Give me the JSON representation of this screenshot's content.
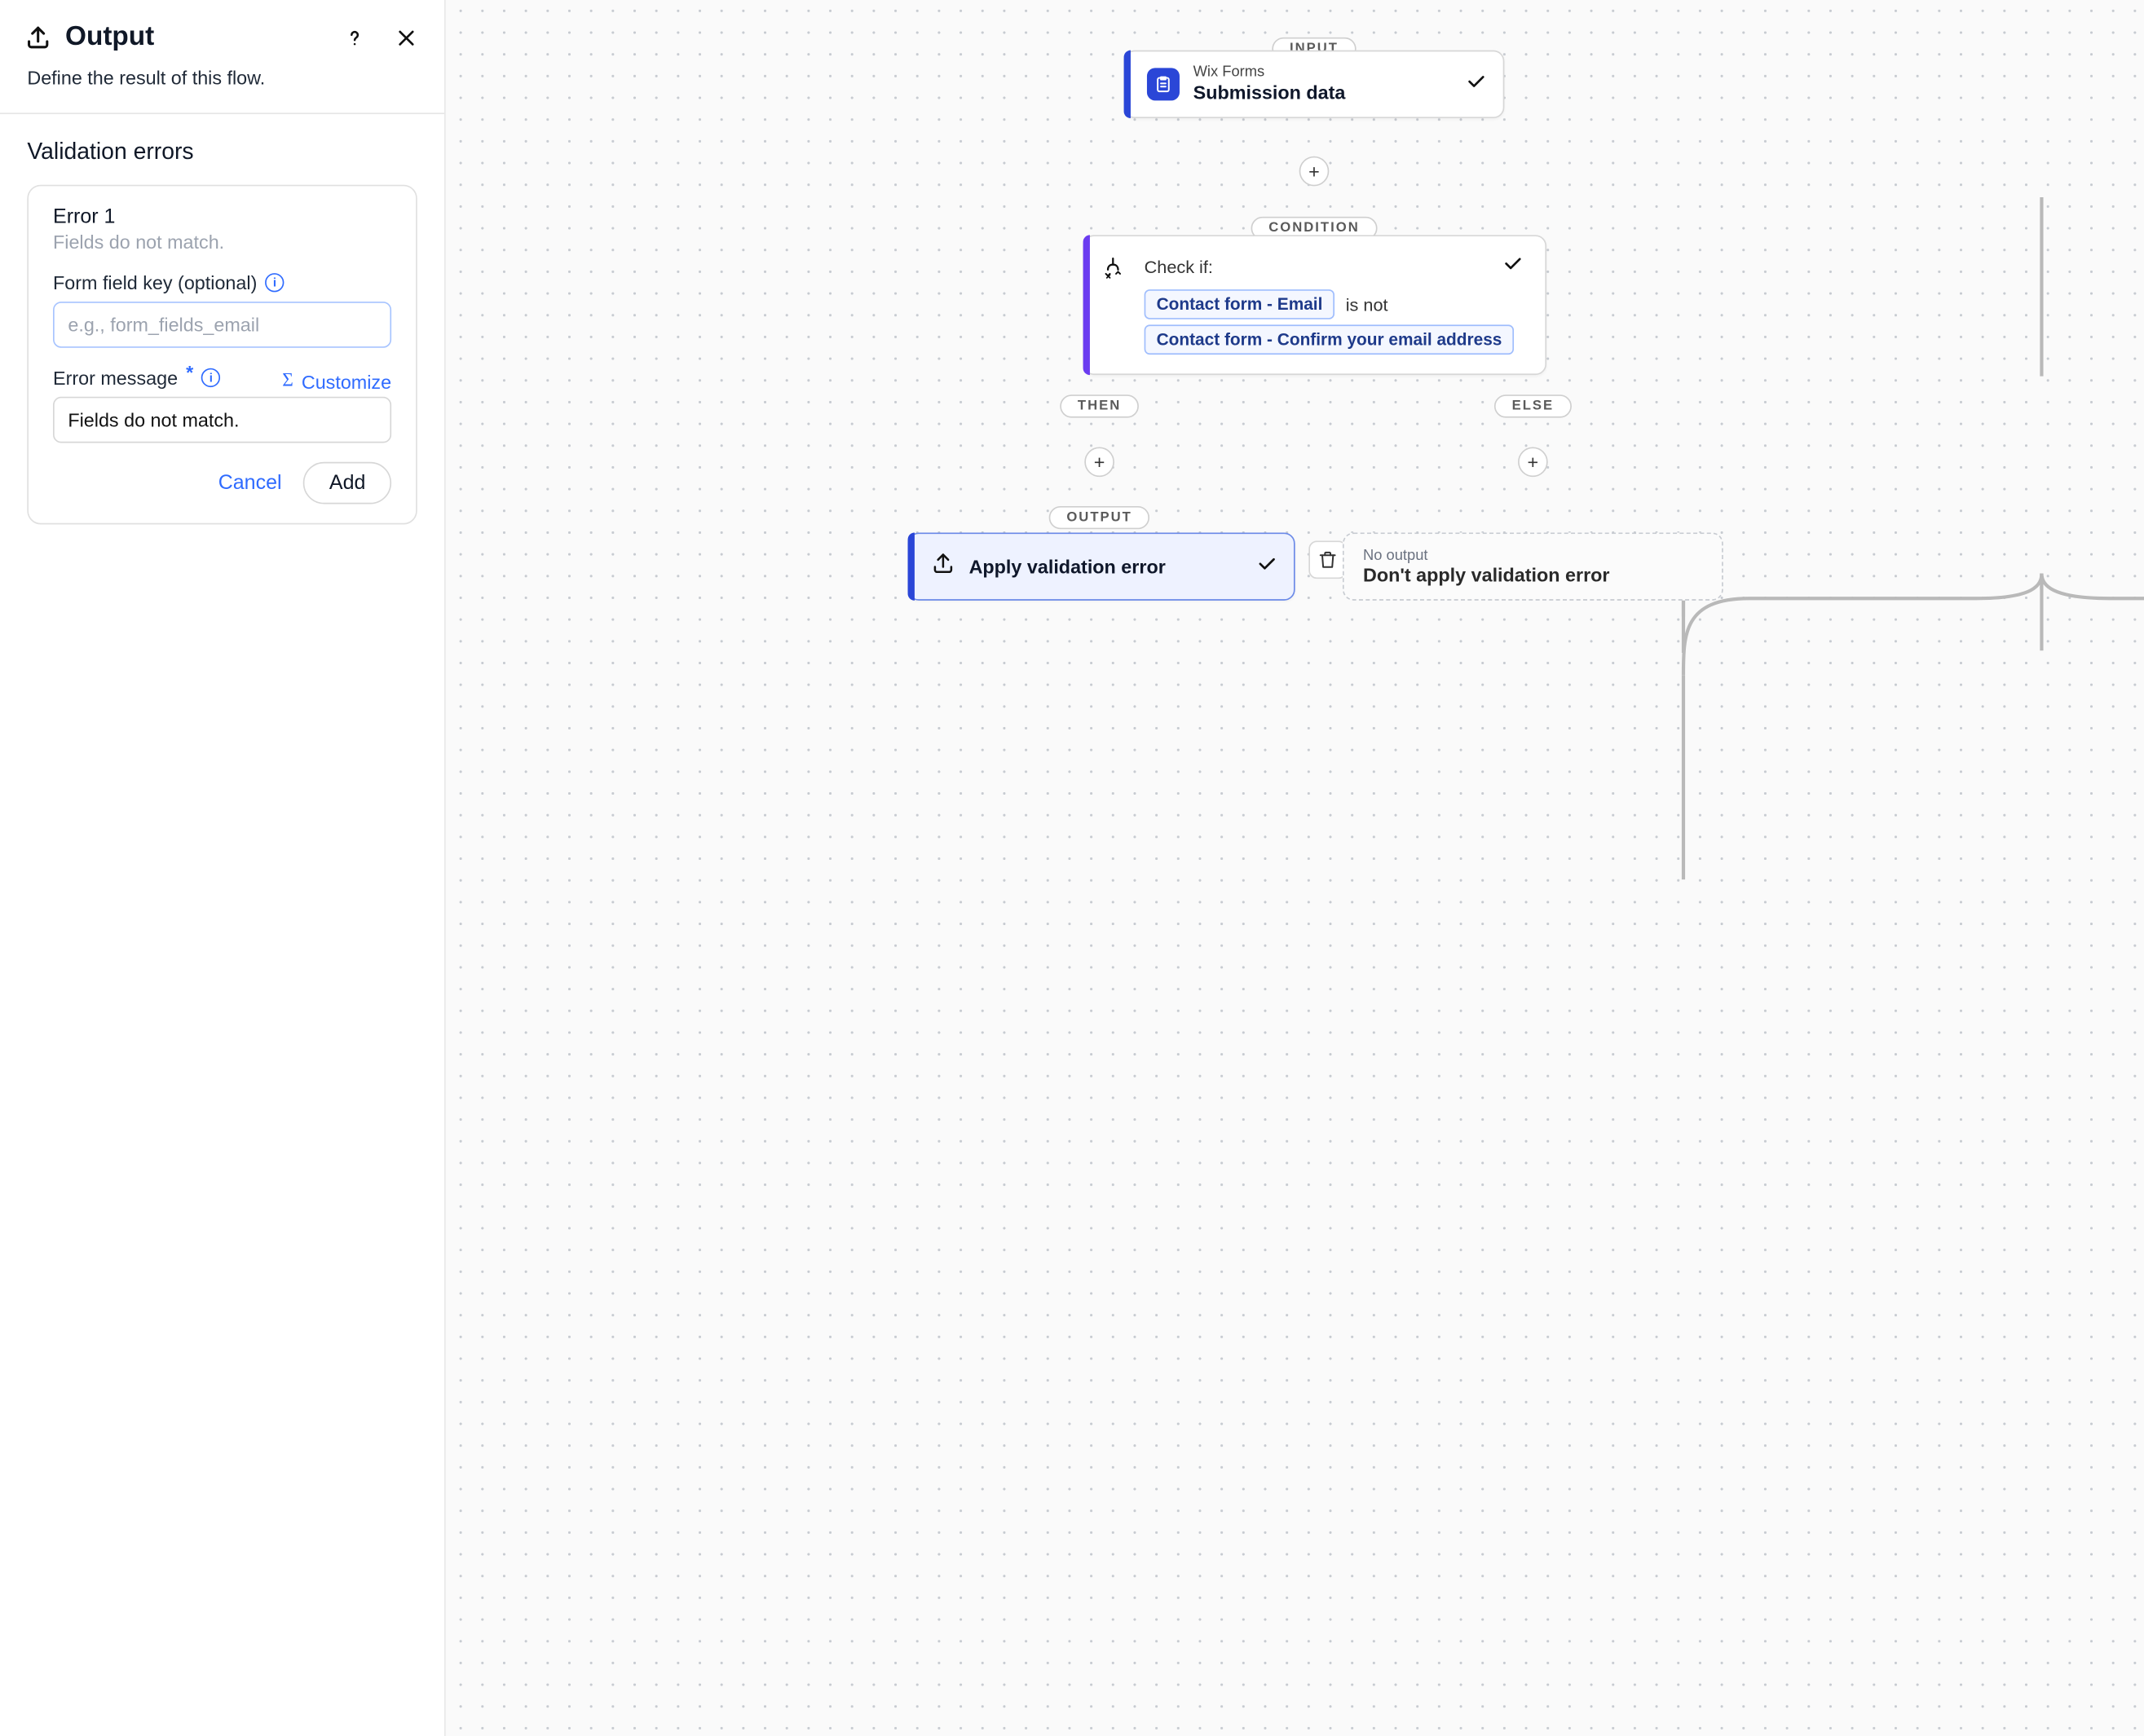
{
  "sidebar": {
    "title": "Output",
    "subtitle": "Define the result of this flow.",
    "section_title": "Validation errors",
    "error": {
      "heading": "Error 1",
      "subheading": "Fields do not match.",
      "field_key": {
        "label": "Form field key (optional)",
        "placeholder": "e.g., form_fields_email",
        "value": ""
      },
      "error_message": {
        "label": "Error message",
        "value": "Fields do not match.",
        "customize_label": "Customize"
      },
      "cancel_label": "Cancel",
      "add_label": "Add"
    }
  },
  "canvas": {
    "badges": {
      "input": "INPUT",
      "condition": "CONDITION",
      "then": "THEN",
      "else": "ELSE",
      "output": "OUTPUT"
    },
    "input_node": {
      "app": "Wix Forms",
      "title": "Submission data"
    },
    "condition_node": {
      "label": "Check if:",
      "chip1": "Contact form - Email",
      "op": "is not",
      "chip2": "Contact form - Confirm your email address"
    },
    "output_node": {
      "title": "Apply validation error"
    },
    "ghost_node": {
      "top": "No output",
      "title": "Don't apply validation error"
    }
  }
}
